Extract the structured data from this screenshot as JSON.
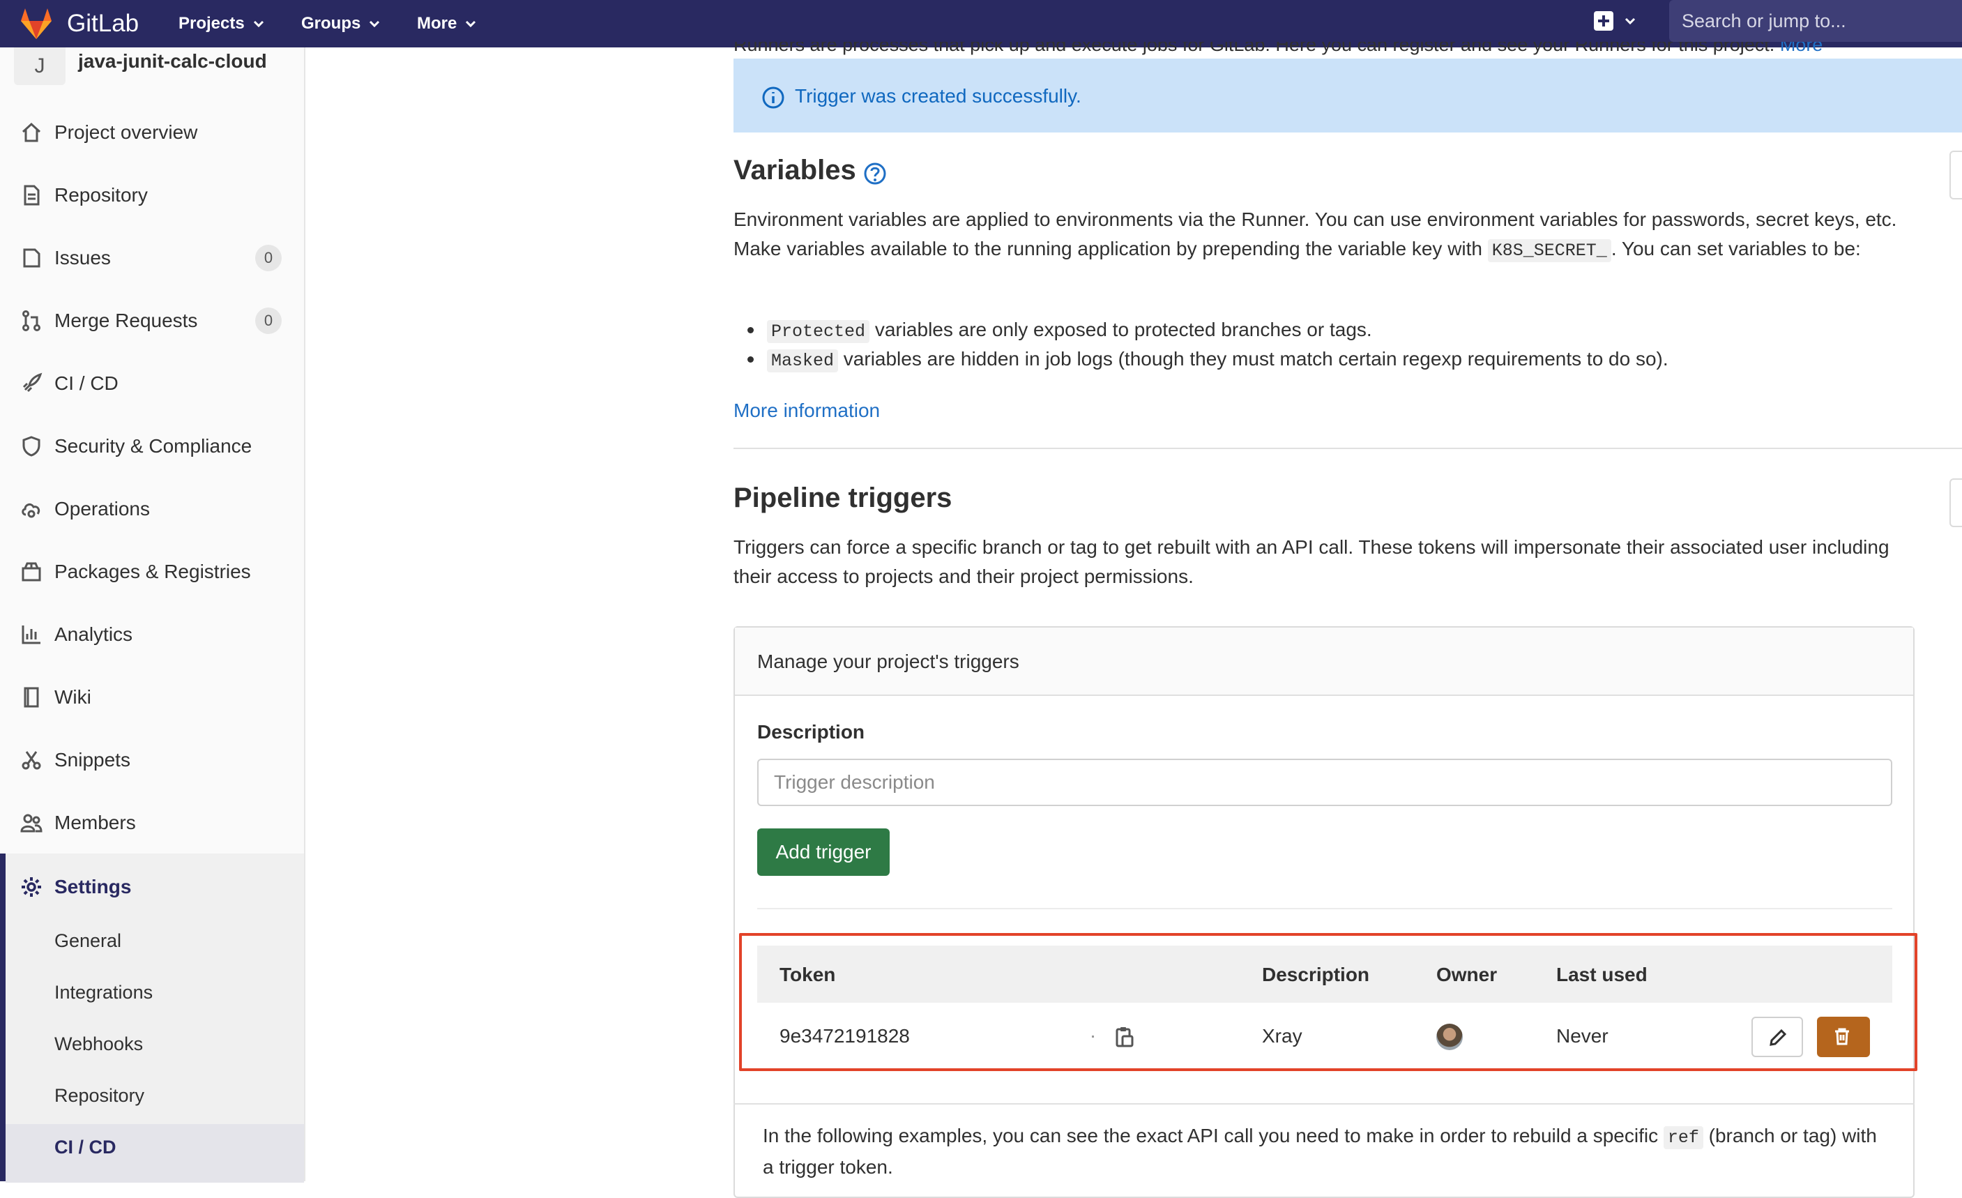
{
  "navbar": {
    "brand": "GitLab",
    "projects": "Projects",
    "groups": "Groups",
    "more": "More",
    "search_placeholder": "Search or jump to..."
  },
  "sidebar": {
    "project_initial": "J",
    "project_name": "java-junit-calc-cloud",
    "items": [
      {
        "label": "Project overview",
        "icon": "home-icon"
      },
      {
        "label": "Repository",
        "icon": "doc-icon"
      },
      {
        "label": "Issues",
        "icon": "issues-icon",
        "count": "0"
      },
      {
        "label": "Merge Requests",
        "icon": "merge-request-icon",
        "count": "0"
      },
      {
        "label": "CI / CD",
        "icon": "rocket-icon"
      },
      {
        "label": "Security & Compliance",
        "icon": "shield-icon"
      },
      {
        "label": "Operations",
        "icon": "cloud-gear-icon"
      },
      {
        "label": "Packages & Registries",
        "icon": "package-icon"
      },
      {
        "label": "Analytics",
        "icon": "chart-icon"
      },
      {
        "label": "Wiki",
        "icon": "book-icon"
      },
      {
        "label": "Snippets",
        "icon": "scissors-icon"
      },
      {
        "label": "Members",
        "icon": "users-icon"
      }
    ],
    "settings": {
      "label": "Settings",
      "sub_items": [
        "General",
        "Integrations",
        "Webhooks",
        "Repository",
        "CI / CD"
      ]
    }
  },
  "content": {
    "runners_text": "Runners are processes that pick up and execute jobs for GitLab. Here you can register and see your Runners for this project.",
    "runners_more": "More",
    "alert": "Trigger was created successfully.",
    "variables": {
      "title": "Variables",
      "para_before": "Environment variables are applied to environments via the Runner. You can use environment variables for passwords, secret keys, etc. Make variables available to the running application by prepending the variable key with",
      "para_code": "K8S_SECRET_",
      "para_after": ". You can set variables to be:",
      "bullet1_code": "Protected",
      "bullet1_text": "variables are only exposed to protected branches or tags.",
      "bullet2_code": "Masked",
      "bullet2_text": "variables are hidden in job logs (though they must match certain regexp requirements to do so).",
      "more_info": "More information"
    },
    "triggers": {
      "title": "Pipeline triggers",
      "para": "Triggers can force a specific branch or tag to get rebuilt with an API call. These tokens will impersonate their associated user including their access to projects and their project permissions.",
      "card_header": "Manage your project's triggers",
      "description_label": "Description",
      "description_placeholder": "Trigger description",
      "add_button": "Add trigger",
      "table": {
        "headers": [
          "Token",
          "Description",
          "Owner",
          "Last used"
        ],
        "rows": [
          {
            "token": "9e3472191828",
            "description": "Xray",
            "last_used": "Never"
          }
        ]
      },
      "examples_before": "In the following examples, you can see the exact API call you need to make in order to rebuild a specific",
      "examples_code": "ref",
      "examples_after": "(branch or tag) with a trigger token."
    }
  },
  "colors": {
    "navbar": "#292961",
    "alert_bg": "#cbe2f9",
    "link": "#1f6fc5",
    "add_button": "#2e7a45",
    "delete_button": "#b5651d",
    "highlight_border": "#e24329"
  }
}
